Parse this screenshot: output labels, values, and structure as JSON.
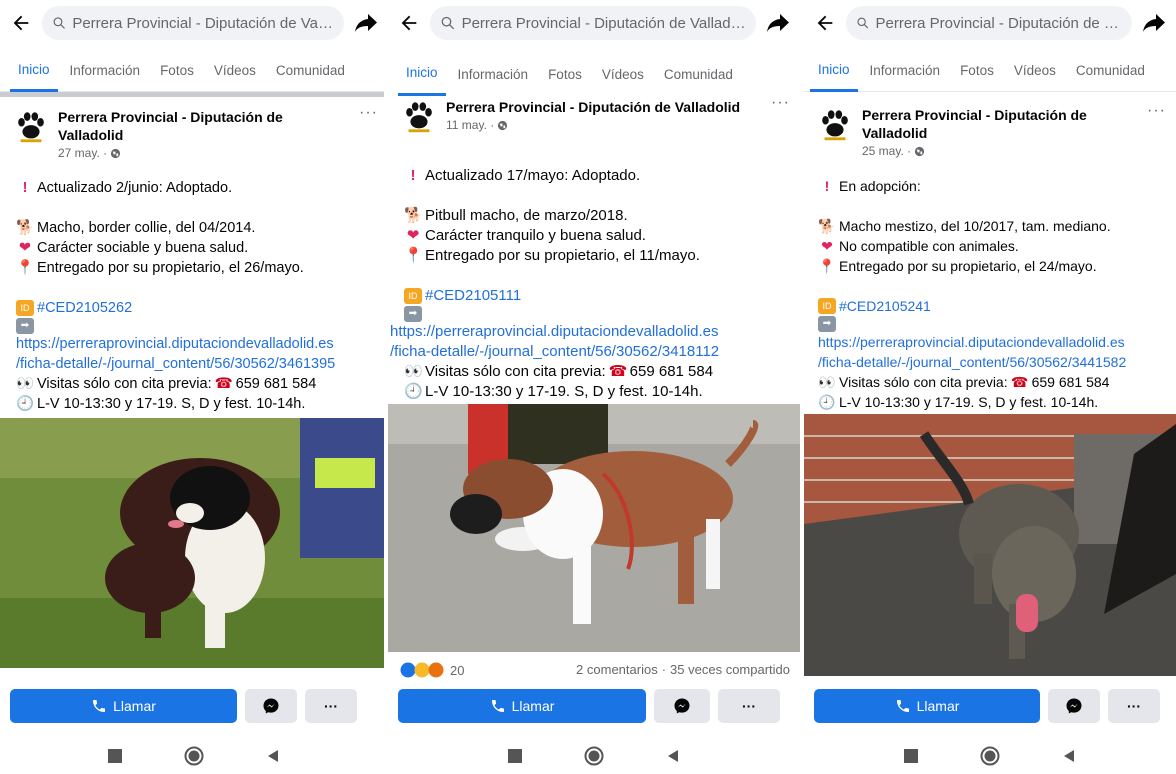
{
  "app": {
    "search_text": "Perrera Provincial - Diputación de Valladolid",
    "tabs": [
      "Inicio",
      "Información",
      "Fotos",
      "Vídeos",
      "Comunidad"
    ],
    "call_label": "Llamar",
    "more_label": "···"
  },
  "posts": [
    {
      "page_name": "Perrera Provincial - Diputación de Valladolid",
      "date": "27 may. ·",
      "status": "Actualizado 2/junio: Adoptado.",
      "line1": "Macho, border collie, del 04/2014.",
      "line2": "Carácter sociable y buena salud.",
      "line3": "Entregado por su propietario, el 26/mayo.",
      "code": "#CED2105262",
      "url1": "https://perreraprovincial.diputaciondevalladolid.es",
      "url2": "/ficha-detalle/-/journal_content/56/30562/3461395",
      "visits": "Visitas sólo con cita previa:",
      "phone": "659 681 584",
      "hours": "L-V 10-13:30 y 17-19. S, D y fest. 10-14h."
    },
    {
      "page_name": "Perrera Provincial - Diputación de Valladolid",
      "date": "11 may. ·",
      "status": "Actualizado 17/mayo: Adoptado.",
      "line1": "Pitbull macho, de marzo/2018.",
      "line2": "Carácter tranquilo y buena salud.",
      "line3": "Entregado por su propietario, el 11/mayo.",
      "code": "#CED2105111",
      "url1": "https://perreraprovincial.diputaciondevalladolid.es",
      "url2": "/ficha-detalle/-/journal_content/56/30562/3418112",
      "visits": "Visitas sólo con cita previa:",
      "phone": "659 681 584",
      "hours": "L-V 10-13:30 y 17-19. S, D y fest. 10-14h.",
      "reaction_count": "20",
      "comments": "2 comentarios",
      "shares": "35 veces compartido"
    },
    {
      "page_name": "Perrera Provincial - Diputación de Valladolid",
      "date": "25 may. ·",
      "status": "En adopción:",
      "line1": "Macho mestizo, del 10/2017, tam. mediano.",
      "line2": "No compatible con animales.",
      "line3": "Entregado por su propietario, el 24/mayo.",
      "code": "#CED2105241",
      "url1": "https://perreraprovincial.diputaciondevalladolid.es",
      "url2": "/ficha-detalle/-/journal_content/56/30562/3441582",
      "visits": "Visitas sólo con cita previa:",
      "phone": "659 681 584",
      "hours": "L-V 10-13:30 y 17-19. S, D y fest. 10-14h."
    }
  ],
  "colors": {
    "accent": "#1b74e4",
    "link": "#216fdb",
    "muted": "#65676b"
  }
}
